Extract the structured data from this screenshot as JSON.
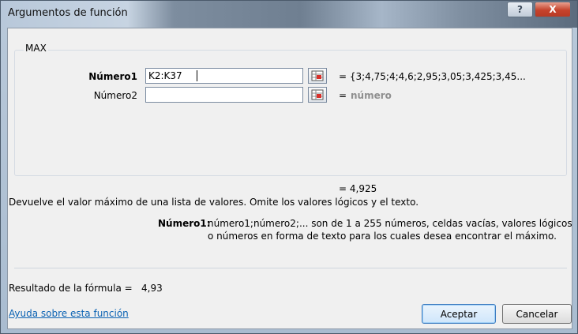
{
  "window": {
    "title": "Argumentos de función",
    "help_label": "?",
    "close_label": "X"
  },
  "function": {
    "name": "MAX"
  },
  "arguments": [
    {
      "label": "Número1",
      "value": "K2:K37",
      "result": "= {3;4,75;4;4,6;2,95;3,05;3,425;3,45..."
    },
    {
      "label": "Número2",
      "value": "",
      "result_eq": "=",
      "result": "número"
    }
  ],
  "function_result": "= 4,925",
  "description": "Devuelve el valor máximo de una lista de valores. Omite los valores lógicos y el texto.",
  "arg_help": {
    "label": "Número1:",
    "line1": "número1;número2;... son de 1 a 255 números, celdas vacías, valores lógicos",
    "line2": "o números en forma de texto para los cuales desea encontrar el máximo."
  },
  "formula_result": {
    "label": "Resultado de la fórmula =",
    "value": "4,93"
  },
  "help_link": "Ayuda sobre esta función",
  "buttons": {
    "accept": "Aceptar",
    "cancel": "Cancelar"
  }
}
